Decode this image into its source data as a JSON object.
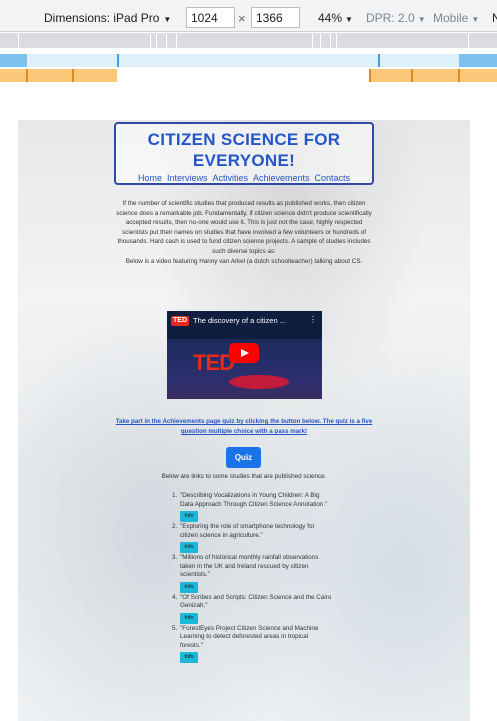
{
  "devtools": {
    "dimensions_label": "Dimensions: iPad Pro",
    "width_value": "1024",
    "times": "×",
    "height_value": "1366",
    "zoom": "44%",
    "dpr": "DPR: 2.0",
    "mode": "Mobile",
    "overflow_label": "N",
    "caret": "▼"
  },
  "site": {
    "title": "CITIZEN SCIENCE FOR EVERYONE!",
    "nav": [
      "Home",
      "Interviews",
      "Activities",
      "Achievements",
      "Contacts"
    ],
    "intro": "If the number of scientific studies that produced results as published works, then citizen science does a remarkable job. Fundamentally, if citizen science didn't produce scientifically accepted results, then no-one would use it. This is just not the case; highly respected scientists put their names on studies that have involved a few volunteers or hundreds of thousands. Hard cash is used to fund citizen science projects. A sample of studies includes such diverse topics as:",
    "video_intro": "Below is a video featuring Hanny van Arkel (a dutch schoolteacher) talking about CS.",
    "video": {
      "logo": "TED",
      "title": "The discovery of a citizen ...",
      "menu": "⋮",
      "stage_text": "TED"
    },
    "quiz_link": "Take part in the Achievements page quiz by clicking the button below. The quiz is a five question multiple choice with a pass mark!",
    "quiz_button": "Quiz",
    "studies_intro": "Below are links to some studies that are published science.",
    "info_label": "Info",
    "studies": [
      {
        "num": "1.",
        "title": "\"Describing Vocalizations in Young Children: A Big Data Approach Through Citizen Science Annotation.\""
      },
      {
        "num": "2.",
        "title": "\"Exploring the role of smartphone technology for citizen science in agriculture.\""
      },
      {
        "num": "3.",
        "title": "\"Millions of historical monthly rainfall observations taken in the UK and Ireland rescued by citizen scientists.\""
      },
      {
        "num": "4.",
        "title": "\"Of Scribes and Scripts: Citizen Science and the Cairo Genizah.\""
      },
      {
        "num": "5.",
        "title": "\"ForestEyes Project Citizen Science and Machine Learning to detect deforested areas in tropical forests.\""
      }
    ]
  },
  "colors": {
    "accent": "#2455c9",
    "button": "#1a73e8",
    "info": "#1bb8d8",
    "mq_blue": "#7cc1ef",
    "mq_orange": "#fbc879"
  }
}
